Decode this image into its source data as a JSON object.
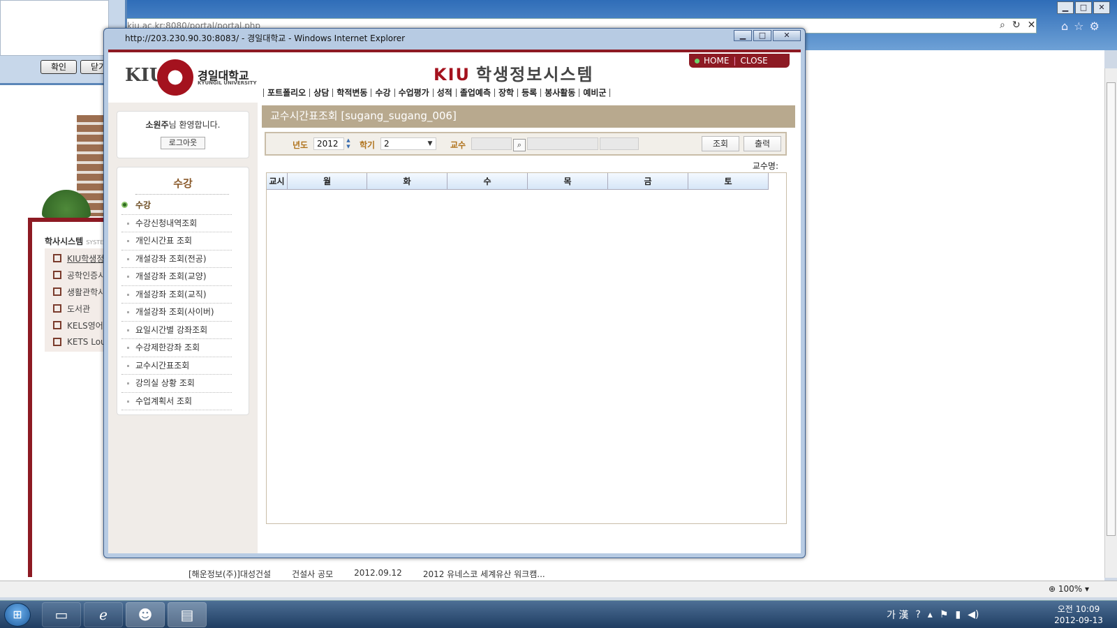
{
  "background_browser": {
    "address_fragment": "kiu.ac.kr:8080/portal/portal.php",
    "zoom": "100%",
    "side_title": "학사시스템",
    "side_title_small": "SYSTE",
    "side_items": [
      {
        "label": "KIU학생정"
      },
      {
        "label": "공학인증시"
      },
      {
        "label": "생활관학사"
      },
      {
        "label": "도서관"
      },
      {
        "label": "KELS영어"
      },
      {
        "label": "KETS Lou"
      }
    ],
    "bottom_row": {
      "col1": "[해운정보(주)]대성건설",
      "col2": "건설사 공모",
      "col3": "2012.09.12",
      "col4": "2012 유네스코 세계유산 워크캠..."
    }
  },
  "dialog": {
    "ok_label": "확인",
    "close_label": "닫기"
  },
  "popup": {
    "title": "http://203.230.90.30:8083/ - 경일대학교 - Windows Internet Explorer",
    "minimize_label": "▁",
    "maximize_label": "□",
    "close_label": "✕"
  },
  "site": {
    "logo_kiu": "KIU",
    "logo_name": "경일대학교",
    "logo_sub": "KYUNGIL UNIVERSITY",
    "system_title_brand": "KIU",
    "system_title": "학생정보시스템",
    "home_label": "HOME",
    "close_label": "CLOSE",
    "nav": [
      "포트폴리오",
      "상담",
      "학적변동",
      "수강",
      "수업평가",
      "성적",
      "졸업예측",
      "장학",
      "등록",
      "봉사활동",
      "예비군"
    ]
  },
  "welcome": {
    "user": "소원주",
    "suffix": "님 환영합니다.",
    "logout_label": "로그아웃"
  },
  "menu": {
    "title": "수강",
    "items": [
      {
        "label": "수강",
        "active": true
      },
      {
        "label": "수강신청내역조회"
      },
      {
        "label": "개인시간표 조회"
      },
      {
        "label": "개설강좌 조회(전공)"
      },
      {
        "label": "개설강좌 조회(교양)"
      },
      {
        "label": "개설강좌 조회(교직)"
      },
      {
        "label": "개설강좌 조회(사이버)"
      },
      {
        "label": "요일시간별 강좌조회"
      },
      {
        "label": "수강제한강좌 조회"
      },
      {
        "label": "교수시간표조회"
      },
      {
        "label": "강의실 상황 조회"
      },
      {
        "label": "수업계획서 조회"
      }
    ]
  },
  "page": {
    "title": "교수시간표조회 [sugang_sugang_006]",
    "search": {
      "year_label": "년도",
      "year_value": "2012",
      "semester_label": "학기",
      "semester_value": "2",
      "professor_label": "교수",
      "professor_id": "",
      "professor_name": "",
      "professor_extra": "",
      "search_button": "조회",
      "print_button": "출력"
    },
    "professor_name_label": "교수명:",
    "timetable_headers": [
      "교시",
      "월",
      "화",
      "수",
      "목",
      "금",
      "토"
    ]
  },
  "taskbar": {
    "ime": "가 漢",
    "time": "오전 10:09",
    "date": "2012-09-13"
  }
}
